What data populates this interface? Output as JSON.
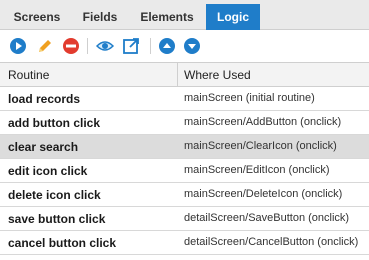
{
  "tabs": [
    {
      "label": "Screens",
      "active": false
    },
    {
      "label": "Fields",
      "active": false
    },
    {
      "label": "Elements",
      "active": false
    },
    {
      "label": "Logic",
      "active": true
    }
  ],
  "toolbar": {
    "icons": [
      "play-icon",
      "edit-icon",
      "delete-icon",
      "view-icon",
      "open-external-icon",
      "move-up-icon",
      "move-down-icon"
    ]
  },
  "grid": {
    "columns": [
      "Routine",
      "Where Used"
    ],
    "rows": [
      {
        "routine": "load records",
        "where_used": "mainScreen (initial routine)",
        "selected": false
      },
      {
        "routine": "add button click",
        "where_used": "mainScreen/AddButton (onclick)",
        "selected": false
      },
      {
        "routine": "clear search",
        "where_used": "mainScreen/ClearIcon (onclick)",
        "selected": true
      },
      {
        "routine": "edit icon click",
        "where_used": "mainScreen/EditIcon (onclick)",
        "selected": false
      },
      {
        "routine": "delete icon click",
        "where_used": "mainScreen/DeleteIcon (onclick)",
        "selected": false
      },
      {
        "routine": "save button click",
        "where_used": "detailScreen/SaveButton (onclick)",
        "selected": false
      },
      {
        "routine": "cancel button click",
        "where_used": "detailScreen/CancelButton (onclick)",
        "selected": false
      }
    ]
  },
  "colors": {
    "accent": "#1f7dc9",
    "delete": "#e23b2e",
    "edit": "#f0a020",
    "selected_row": "#dcdcdc"
  }
}
